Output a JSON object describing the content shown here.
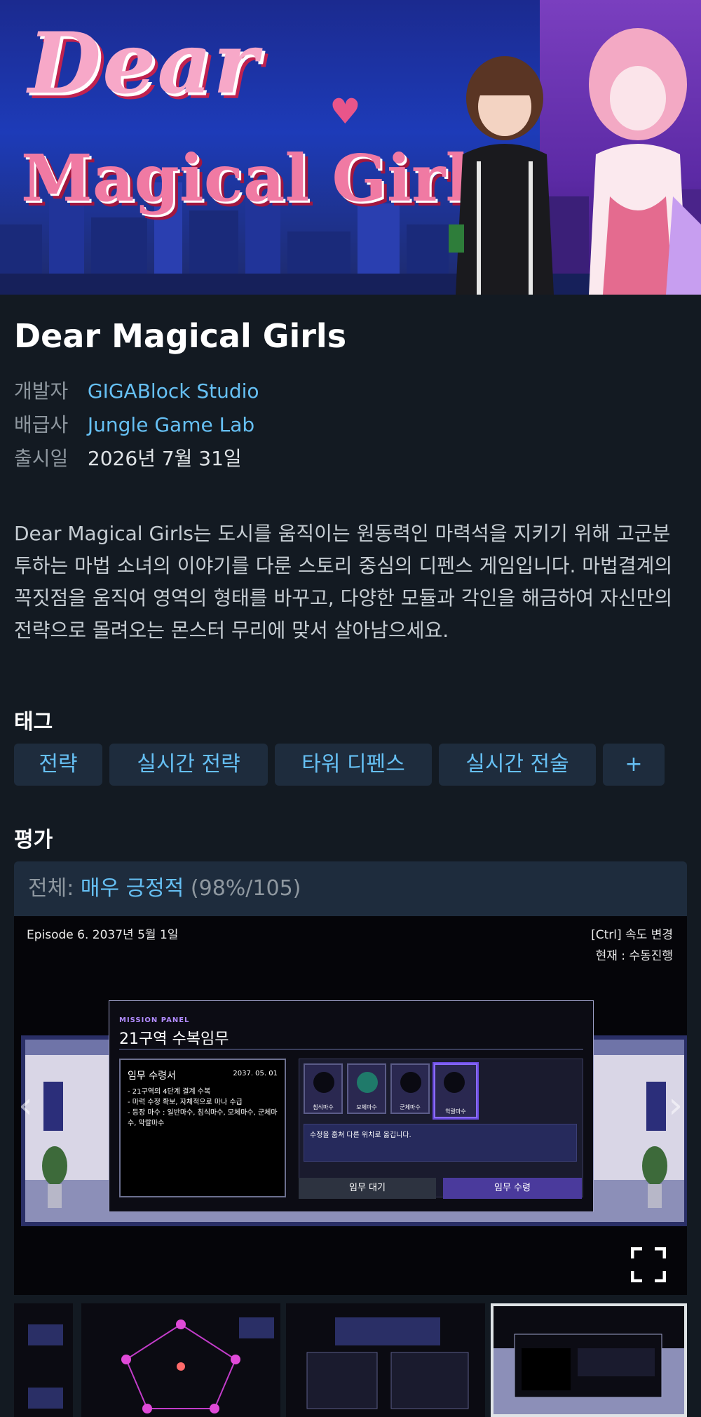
{
  "banner": {
    "logo_line1": "Dear",
    "logo_line2": "Magical Girls"
  },
  "game": {
    "title": "Dear Magical Girls",
    "developer_label": "개발자",
    "developer": "GIGABlock Studio",
    "publisher_label": "배급사",
    "publisher": "Jungle Game Lab",
    "release_label": "출시일",
    "release_date": "2026년 7월 31일",
    "description": "Dear Magical Girls는 도시를 움직이는 원동력인 마력석을 지키기 위해 고군분투하는 마법 소녀의 이야기를 다룬 스토리 중심의 디펜스 게임입니다. 마법결계의 꼭짓점을 움직여 영역의 형태를 바꾸고, 다양한 모듈과 각인을 해금하여 자신만의 전략으로 몰려오는 몬스터 무리에 맞서 살아남으세요."
  },
  "tags": {
    "heading": "태그",
    "items": [
      "전략",
      "실시간 전략",
      "타워 디펜스",
      "실시간 전술",
      "+"
    ]
  },
  "reviews": {
    "heading": "평가",
    "overall_label": "전체: ",
    "overall_value": "매우 긍정적",
    "overall_stats": " (98%/105)"
  },
  "screenshot": {
    "episode": "Episode 6. 2037년 5월 1일",
    "ctrl_hint": "[Ctrl] 속도 변경",
    "mode": "현재 : 수동진행",
    "panel_label": "MISSION PANEL",
    "panel_title": "21구역 수복임무",
    "order_title": "임무 수령서",
    "order_date": "2037. 05. 01",
    "order_lines": [
      "- 21구역의 4단계 결계 수복",
      "- 마력 수정 확보, 자체적으로 마나 수급",
      "- 등장 마수 : 일반마수, 침식마수, 모체마수, 군체마수, 악랄마수"
    ],
    "monsters": [
      "침식마수",
      "모체마수",
      "군체마수",
      "악랄마수"
    ],
    "message": "수정을 훔쳐 다른 위치로 옮깁니다.",
    "wait_button": "임무 대기",
    "accept_button": "임무 수령"
  },
  "colors": {
    "background": "#131a22",
    "link": "#66c0f4",
    "tag_bg": "#1e2c3d"
  }
}
